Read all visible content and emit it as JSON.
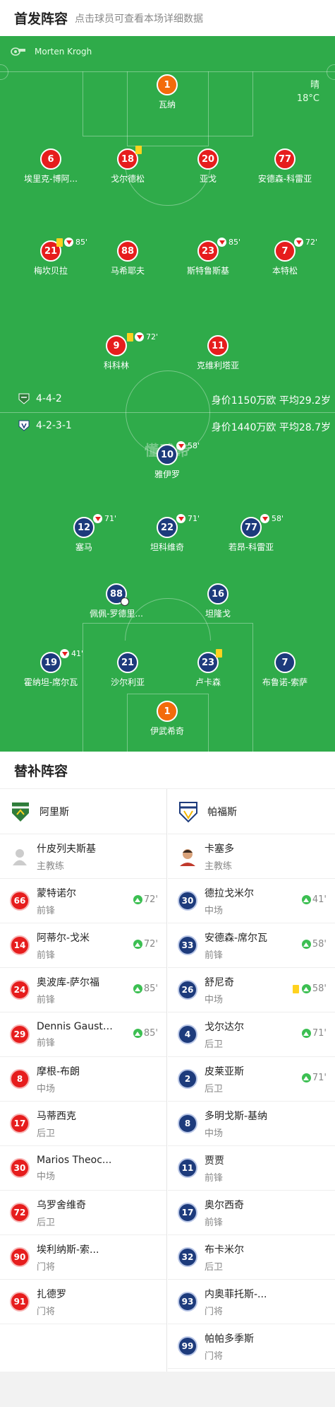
{
  "header": {
    "title": "首发阵容",
    "subtitle": "点击球员可查看本场详细数据"
  },
  "pitch": {
    "referee": "Morten Krogh",
    "weather": {
      "condition": "晴",
      "temp": "18°C"
    },
    "watermark": "懂球帝",
    "home": {
      "formation": "4-4-2",
      "info": "身价1150万欧 平均29.2岁",
      "color": "#e61d1d"
    },
    "away": {
      "formation": "4-2-3-1",
      "info": "身价1440万欧 平均28.7岁",
      "color": "#1d3b7c"
    }
  },
  "home_players": [
    {
      "num": "1",
      "name": "瓦纳",
      "gk": true
    },
    {
      "num": "6",
      "name": "埃里克-博阿..."
    },
    {
      "num": "18",
      "name": "戈尔德松",
      "yellow": true
    },
    {
      "num": "20",
      "name": "亚戈"
    },
    {
      "num": "77",
      "name": "安德森-科雷亚"
    },
    {
      "num": "21",
      "name": "梅坎贝拉",
      "yellow": true,
      "sub_off": "85'"
    },
    {
      "num": "88",
      "name": "马希耶夫"
    },
    {
      "num": "23",
      "name": "斯特鲁斯基",
      "sub_off": "85'"
    },
    {
      "num": "7",
      "name": "本特松",
      "sub_off": "72'"
    },
    {
      "num": "9",
      "name": "科科林",
      "yellow": true,
      "sub_off": "72'"
    },
    {
      "num": "11",
      "name": "克维利塔亚"
    }
  ],
  "away_players": [
    {
      "num": "10",
      "name": "雅伊罗",
      "sub_off": "58'"
    },
    {
      "num": "12",
      "name": "塞马",
      "sub_off": "71'"
    },
    {
      "num": "22",
      "name": "坦科维奇",
      "sub_off": "71'"
    },
    {
      "num": "77",
      "name": "若昂-科雷亚",
      "sub_off": "58'"
    },
    {
      "num": "88",
      "name": "佩佩-罗德里...",
      "goal": true
    },
    {
      "num": "16",
      "name": "坦隆戈"
    },
    {
      "num": "19",
      "name": "霍纳坦-席尔瓦",
      "sub_off": "41'"
    },
    {
      "num": "21",
      "name": "沙尔利亚"
    },
    {
      "num": "23",
      "name": "卢卡森",
      "yellow": true
    },
    {
      "num": "7",
      "name": "布鲁诺-索萨"
    },
    {
      "num": "1",
      "name": "伊武希奇",
      "gk": true
    }
  ],
  "subs": {
    "title": "替补阵容",
    "home": {
      "team": "阿里斯",
      "coach": {
        "name": "什皮列夫斯基",
        "role": "主教练"
      },
      "players": [
        {
          "num": "66",
          "name": "蒙特诺尔",
          "pos": "前锋",
          "sub_on": "72'"
        },
        {
          "num": "14",
          "name": "阿蒂尔-戈米",
          "pos": "前锋",
          "sub_on": "72'"
        },
        {
          "num": "24",
          "name": "奥波库-萨尔福",
          "pos": "前锋",
          "sub_on": "85'"
        },
        {
          "num": "29",
          "name": "Dennis Gaustad",
          "pos": "前锋",
          "sub_on": "85'"
        },
        {
          "num": "8",
          "name": "摩根-布朗",
          "pos": "中场"
        },
        {
          "num": "17",
          "name": "马蒂西克",
          "pos": "后卫"
        },
        {
          "num": "30",
          "name": "Marios Theoc...",
          "pos": "中场"
        },
        {
          "num": "72",
          "name": "乌罗舍维奇",
          "pos": "后卫"
        },
        {
          "num": "90",
          "name": "埃利纳斯-索...",
          "pos": "门将"
        },
        {
          "num": "91",
          "name": "扎德罗",
          "pos": "门将"
        }
      ]
    },
    "away": {
      "team": "帕福斯",
      "coach": {
        "name": "卡塞多",
        "role": "主教练"
      },
      "players": [
        {
          "num": "30",
          "name": "德拉戈米尔",
          "pos": "中场",
          "sub_on": "41'"
        },
        {
          "num": "33",
          "name": "安德森-席尔瓦",
          "pos": "前锋",
          "sub_on": "58'"
        },
        {
          "num": "26",
          "name": "舒尼奇",
          "pos": "中场",
          "sub_on": "58'",
          "yellow": true
        },
        {
          "num": "4",
          "name": "戈尔达尔",
          "pos": "后卫",
          "sub_on": "71'"
        },
        {
          "num": "2",
          "name": "皮莱亚斯",
          "pos": "后卫",
          "sub_on": "71'"
        },
        {
          "num": "8",
          "name": "多明戈斯-基纳",
          "pos": "中场"
        },
        {
          "num": "11",
          "name": "贾贾",
          "pos": "前锋"
        },
        {
          "num": "17",
          "name": "奥尔西奇",
          "pos": "前锋"
        },
        {
          "num": "32",
          "name": "布卡米尔",
          "pos": "后卫"
        },
        {
          "num": "93",
          "name": "内奥菲托斯-...",
          "pos": "门将"
        },
        {
          "num": "99",
          "name": "帕帕多季斯",
          "pos": "门将"
        }
      ]
    }
  }
}
